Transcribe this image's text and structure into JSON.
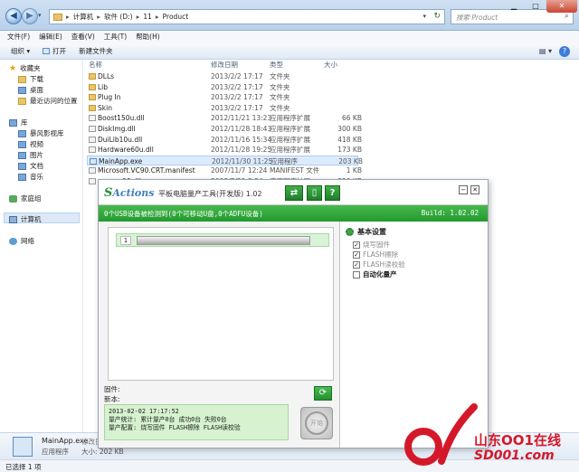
{
  "explorer": {
    "address": [
      "计算机",
      "软件 (D:)",
      "11",
      "Product"
    ],
    "search_placeholder": "搜索 Product",
    "menu": [
      "文件(F)",
      "编辑(E)",
      "查看(V)",
      "工具(T)",
      "帮助(H)"
    ],
    "toolbar": {
      "organize": "组织 ▾",
      "open": "打开",
      "new_folder": "新建文件夹"
    },
    "sidebar": {
      "favorites": "收藏夹",
      "favorites_items": [
        "下载",
        "桌面",
        "最近访问的位置"
      ],
      "library": "库",
      "library_items": [
        "暴风影视库",
        "视频",
        "图片",
        "文档",
        "音乐"
      ],
      "homegroup": "家庭组",
      "computer": "计算机",
      "network": "网络"
    },
    "columns": {
      "name": "名称",
      "date": "修改日期",
      "type": "类型",
      "size": "大小"
    },
    "files": [
      {
        "name": "DLLs",
        "date": "2013/2/2 17:17",
        "type": "文件夹",
        "size": "",
        "kind": "folder"
      },
      {
        "name": "Lib",
        "date": "2013/2/2 17:17",
        "type": "文件夹",
        "size": "",
        "kind": "folder"
      },
      {
        "name": "Plug In",
        "date": "2013/2/2 17:17",
        "type": "文件夹",
        "size": "",
        "kind": "folder"
      },
      {
        "name": "Skin",
        "date": "2013/2/2 17:17",
        "type": "文件夹",
        "size": "",
        "kind": "folder"
      },
      {
        "name": "Boost150u.dll",
        "date": "2012/11/21 13:23",
        "type": "应用程序扩展",
        "size": "66 KB",
        "kind": "dll"
      },
      {
        "name": "DiskImg.dll",
        "date": "2012/11/28 18:43",
        "type": "应用程序扩展",
        "size": "300 KB",
        "kind": "dll"
      },
      {
        "name": "DuiLib10u.dll",
        "date": "2012/11/16 15:34",
        "type": "应用程序扩展",
        "size": "418 KB",
        "kind": "dll"
      },
      {
        "name": "Hardware60u.dll",
        "date": "2012/11/28 19:25",
        "type": "应用程序扩展",
        "size": "173 KB",
        "kind": "dll"
      },
      {
        "name": "MainApp.exe",
        "date": "2012/11/30 11:25",
        "type": "应用程序",
        "size": "203 KB",
        "kind": "exe"
      },
      {
        "name": "Microsoft.VC90.CRT.manifest",
        "date": "2007/11/7 12:24",
        "type": "MANIFEST 文件",
        "size": "1 KB",
        "kind": "dll"
      },
      {
        "name": "msvcm90.dll",
        "date": "2008/7/29 8:54",
        "type": "应用程序扩展",
        "size": "220 KB",
        "kind": "dll"
      }
    ],
    "details": {
      "name": "MainApp.exe",
      "extra": "修改日",
      "type": "应用程序",
      "size": "大小: 202 KB"
    },
    "status": "已选择 1 项"
  },
  "tool": {
    "logo": "Actions",
    "title": "平板电脑量产工具(开发版) 1.02",
    "status_left": "0个USB设备被检测到(0个可移动U盘,0个ADFU设备)",
    "status_right": "Build: 1.02.02",
    "device_num": "1",
    "settings_title": "基本设置",
    "settings": [
      {
        "label": "烧写固件",
        "checked": true,
        "disabled": true
      },
      {
        "label": "FLASH擦除",
        "checked": true,
        "disabled": true
      },
      {
        "label": "FLASH读校验",
        "checked": true,
        "disabled": true
      },
      {
        "label": "自动化量产",
        "checked": false,
        "disabled": false
      }
    ],
    "firmware_label": "固件:",
    "device_label": "新本:",
    "log": [
      "2013-02-02 17:17:52",
      "量产统计: 累计量产0台 成功0台 失败0台",
      "量产配置: 烧写固件 FLASH擦除 FLASH读校验"
    ],
    "start_label": "开始"
  },
  "watermark": {
    "text": "山东OO1在线",
    "url": "SD001.com"
  },
  "colors": {
    "tool_green": "#2aa334",
    "selection": "#dcebfc",
    "watermark": "#d4182a"
  }
}
